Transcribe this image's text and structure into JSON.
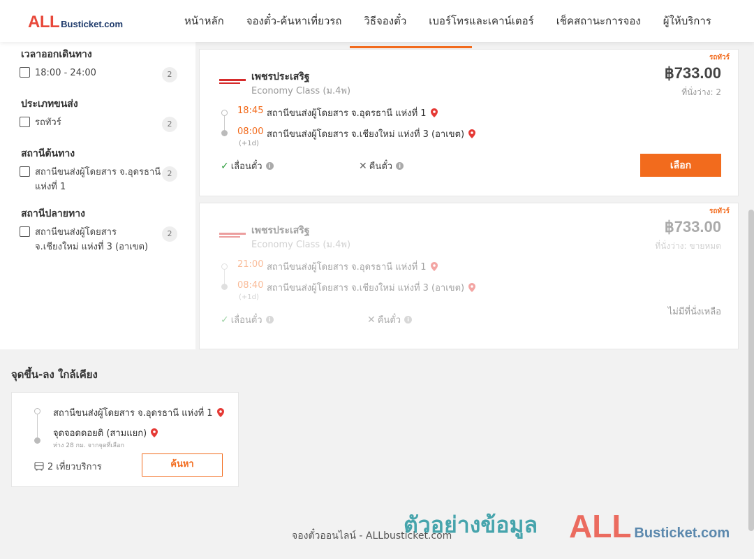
{
  "header": {
    "logo_all": "ALL",
    "logo_rest": "Busticket.com",
    "nav": [
      "หน้าหลัก",
      "จองตั๋ว-ค้นหาเที่ยวรถ",
      "วิธีจองตั๋ว",
      "เบอร์โทรและเคาน์เตอร์",
      "เช็คสถานะการจอง",
      "ผู้ให้บริการ"
    ]
  },
  "filters": {
    "departure": {
      "title": "เวลาออกเดินทาง",
      "option": "18:00 - 24:00",
      "count": "2"
    },
    "bus_type": {
      "title": "ประเภทขนส่ง",
      "option": "รถทัวร์",
      "count": "2"
    },
    "origin": {
      "title": "สถานีต้นทาง",
      "option": "สถานีขนส่งผู้โดยสาร จ.อุดรธานี แห่งที่ 1",
      "count": "2"
    },
    "destination": {
      "title": "สถานีปลายทาง",
      "option": "สถานีขนส่งผู้โดยสาร จ.เชียงใหม่ แห่งที่ 3 (อาเขต)",
      "count": "2"
    }
  },
  "results": [
    {
      "tag": "รถทัวร์",
      "operator": "เพชรประเสริฐ",
      "class": "Economy Class (ม.4พ)",
      "price": "฿733.00",
      "seats": "ที่นั่งว่าง: 2",
      "depart_time": "18:45",
      "depart_station": "สถานีขนส่งผู้โดยสาร จ.อุดรธานี แห่งที่ 1",
      "arrive_time": "08:00",
      "arrive_station": "สถานีขนส่งผู้โดยสาร จ.เชียงใหม่ แห่งที่ 3 (อาเขต)",
      "next_day": "(+1d)",
      "postpone": "เลื่อนตั๋ว",
      "refund": "คืนตั๋ว",
      "action": "เลือก"
    },
    {
      "tag": "รถทัวร์",
      "operator": "เพชรประเสริฐ",
      "class": "Economy Class (ม.4พ)",
      "price": "฿733.00",
      "seats": "ที่นั่งว่าง: ขายหมด",
      "depart_time": "21:00",
      "depart_station": "สถานีขนส่งผู้โดยสาร จ.อุดรธานี แห่งที่ 1",
      "arrive_time": "08:40",
      "arrive_station": "สถานีขนส่งผู้โดยสาร จ.เชียงใหม่ แห่งที่ 3 (อาเขต)",
      "next_day": "(+1d)",
      "postpone": "เลื่อนตั๋ว",
      "refund": "คืนตั๋ว",
      "status": "ไม่มีที่นั่งเหลือ"
    }
  ],
  "nearby": {
    "title": "จุดขึ้น-ลง ใกล้เคียง",
    "from": "สถานีขนส่งผู้โดยสาร จ.อุดรธานี แห่งที่ 1",
    "to": "จุดจอดดอยติ (สามแยก)",
    "distance": "ห่าง 28 กม. จากจุดที่เลือก",
    "trips": "2 เที่ยวบริการ",
    "button": "ค้นหา"
  },
  "footer": {
    "text": "จองตั๋วออนไลน์ - ALLbusticket.com",
    "watermark_thai": "ตัวอย่างข้อมูล",
    "watermark_all": "ALL",
    "watermark_rest": "Busticket.com"
  },
  "colors": {
    "accent": "#f26b1d",
    "logo_red": "#e8483a",
    "pin_red": "#e53935"
  }
}
